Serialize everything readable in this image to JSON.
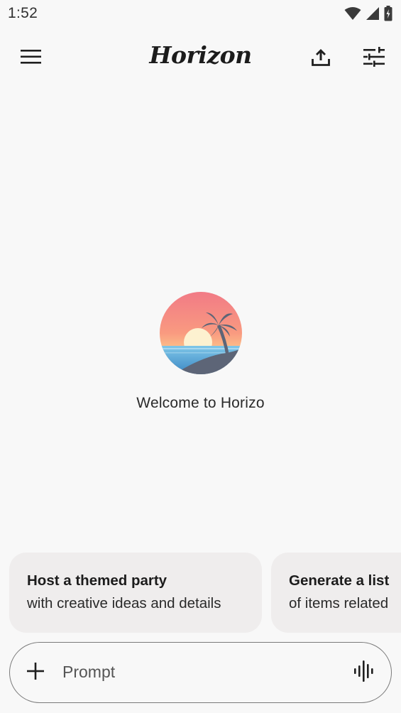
{
  "status_bar": {
    "time": "1:52",
    "icons": [
      "wifi-icon",
      "cell-signal-icon",
      "battery-charging-icon"
    ]
  },
  "app_bar": {
    "title": "Horizon",
    "left_icon": "menu-icon",
    "right_icons": [
      "upload-icon",
      "tune-icon"
    ]
  },
  "hero": {
    "welcome_text": "Welcome to Horizo",
    "logo": "sunset-beach-palm-logo"
  },
  "suggestions": [
    {
      "title": "Host a themed party",
      "subtitle": "with creative ideas and details"
    },
    {
      "title": "Generate a list",
      "subtitle": "of items related"
    }
  ],
  "prompt": {
    "placeholder": "Prompt",
    "value": "",
    "add_icon": "plus-icon",
    "voice_icon": "voice-waveform-icon"
  },
  "colors": {
    "background": "#f8f8f8",
    "card": "#efeded",
    "text": "#1f1f1f",
    "border": "#7a7a7a"
  }
}
